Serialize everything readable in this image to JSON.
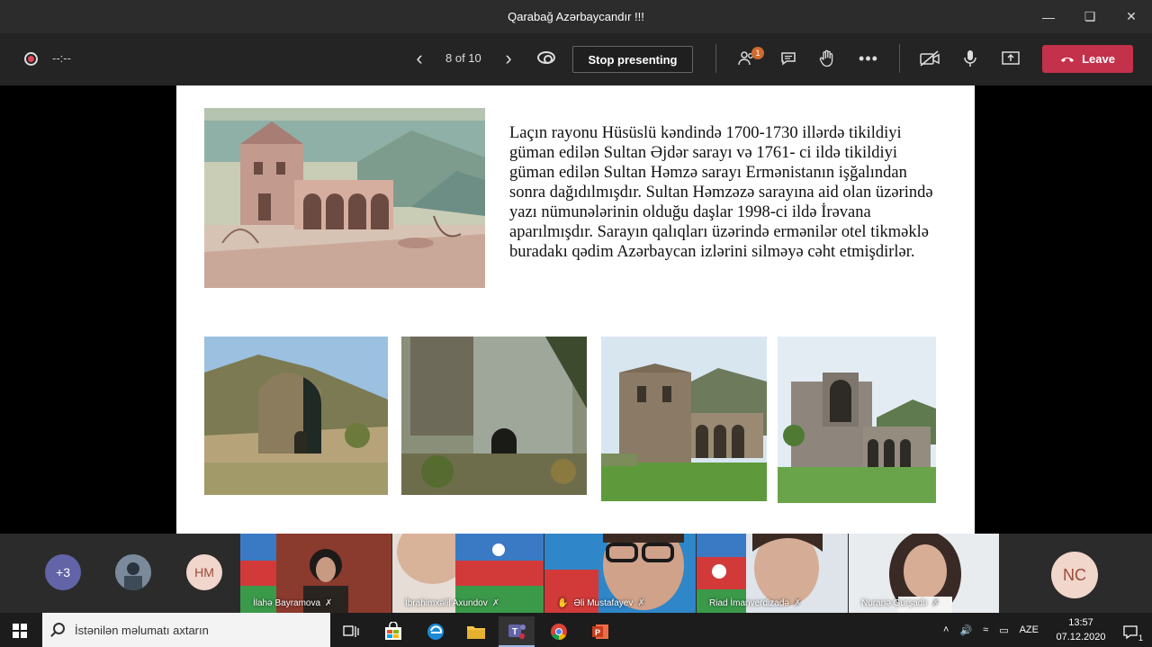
{
  "window": {
    "title": "Qarabağ Azərbaycandır !!!"
  },
  "toolbar": {
    "timer": "--:--",
    "slide_counter": "8 of 10",
    "stop_label": "Stop presenting",
    "participants_badge": "1",
    "leave_label": "Leave"
  },
  "slide": {
    "body": "Laçın rayonu Hüsüslü kəndində 1700-1730 illərdə tikildiyi güman edilən Sultan Əjdər sarayı və 1761- ci ildə tikildiyi güman edilən Sultan Həmzə sarayı Ermənistanın işğalından sonra dağıdılmışdır. Sultan Həmzəzə sarayına aid olan üzərində yazı nümunələrinin olduğu daşlar 1998-ci ildə İrəvana aparılmışdır. Sarayın qalıqları üzərində ermənilər otel tikməklə buradakı qədim Azərbaycan izlərini silməyə cəht etmişdirlər."
  },
  "participants": {
    "overflow": "+3",
    "initials_1": "HM",
    "initials_2": "NC",
    "tiles": [
      {
        "name": "İlahə Bayramova"
      },
      {
        "name": "İbrahimxəlil Axundov"
      },
      {
        "name": "Əli Mustafayev"
      },
      {
        "name": "Riad İmanverdizadə"
      },
      {
        "name": "Nuranə Gürşadlı"
      }
    ]
  },
  "taskbar": {
    "search_placeholder": "İstənilən məlumatı axtarın",
    "language": "AZE",
    "time": "13:57",
    "date": "07.12.2020",
    "notifications": "1"
  },
  "colors": {
    "leave": "#c4314b",
    "badge": "#d06b2d",
    "teams_purple": "#6264a7"
  }
}
